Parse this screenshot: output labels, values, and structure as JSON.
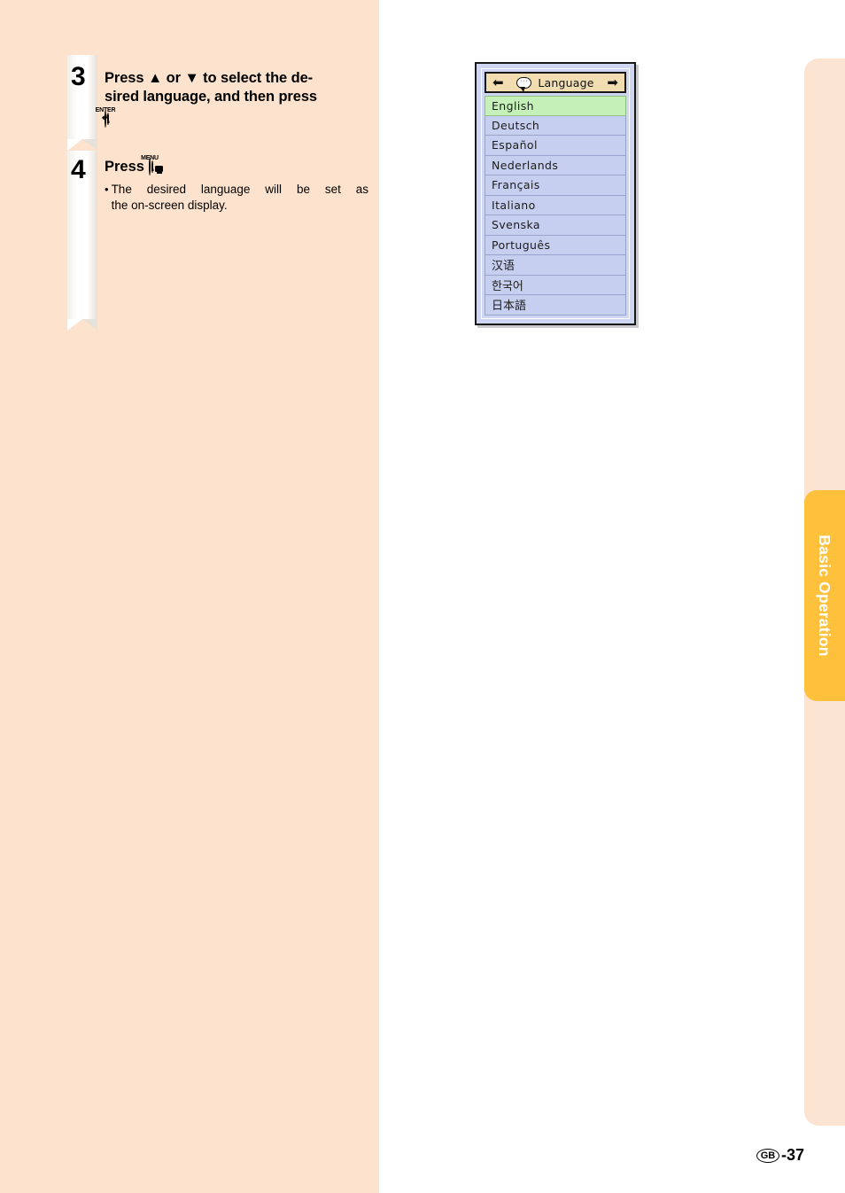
{
  "page": {
    "background_left_color": "#fde3cd",
    "background_right_color": "#fce4d2"
  },
  "side_tab": {
    "label": "Basic Operation",
    "color": "#ffc13c",
    "text_color": "#ffffff"
  },
  "steps": [
    {
      "number": "3",
      "lines": [
        "Press ▲ or ▼ to select the de-",
        "sired language, and then press"
      ],
      "key": {
        "cap": "ENTER",
        "icon": "enter-key-icon",
        "glyph": "↵"
      },
      "trailing": "."
    },
    {
      "number": "4",
      "press_label": "Press",
      "key": {
        "cap": "MENU",
        "icon": "menu-key-icon"
      },
      "trailing": ".",
      "bullet": {
        "marker": "•",
        "line1": "The desired language will be set as",
        "line2": "the on-screen display."
      }
    }
  ],
  "osd_menu": {
    "header": {
      "title": "Language",
      "left_arrow": "⬅",
      "right_arrow": "➡",
      "icon": "speech-bubble-icon",
      "bubble_dots": "···",
      "background": "#f2ddb0"
    },
    "selected_index": 0,
    "selected_color": "#c5f0b8",
    "row_color": "#c7cff1",
    "items": [
      {
        "label": "English",
        "cjk": false
      },
      {
        "label": "Deutsch",
        "cjk": false
      },
      {
        "label": "Español",
        "cjk": false
      },
      {
        "label": "Nederlands",
        "cjk": false
      },
      {
        "label": "Français",
        "cjk": false
      },
      {
        "label": "Italiano",
        "cjk": false
      },
      {
        "label": "Svenska",
        "cjk": false
      },
      {
        "label": "Português",
        "cjk": false
      },
      {
        "label": "汉语",
        "cjk": true
      },
      {
        "label": "한국어",
        "cjk": true
      },
      {
        "label": "日本語",
        "cjk": true
      }
    ]
  },
  "footer": {
    "region_code": "GB",
    "page_number": "-37"
  }
}
